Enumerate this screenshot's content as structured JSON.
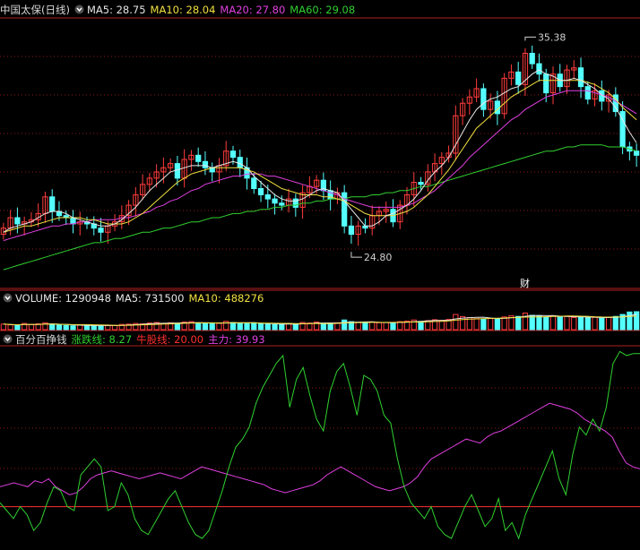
{
  "price_panel": {
    "stock_name": "中国太保(日线)",
    "ma_legend": [
      {
        "label": "MA5: 28.75",
        "color": "#e6e6e6"
      },
      {
        "label": "MA10: 28.04",
        "color": "#f0e040"
      },
      {
        "label": "MA20: 27.80",
        "color": "#e040e0"
      },
      {
        "label": "MA60: 29.08",
        "color": "#30d030"
      }
    ],
    "high_label": "35.38",
    "low_label": "24.80",
    "marker_label": "财"
  },
  "volume_panel": {
    "legend": [
      {
        "label": "VOLUME: 1290948",
        "color": "#e6e6e6"
      },
      {
        "label": "MA5: 731500",
        "color": "#e6e6e6"
      },
      {
        "label": "MA10: 488276",
        "color": "#f0e040"
      }
    ]
  },
  "indicator_panel": {
    "name": "百分百挣钱",
    "legend": [
      {
        "label": "涨跌线: 8.27",
        "color": "#30d030"
      },
      {
        "label": "牛股线: 20.00",
        "color": "#ff3030"
      },
      {
        "label": "主力: 39.93",
        "color": "#e040e0"
      }
    ]
  },
  "colors": {
    "up": "#ff3c3c",
    "down": "#54ffff",
    "grid": "#8b1a1a",
    "frame": "#b02020",
    "ma5": "#e6e6e6",
    "ma10": "#f0e040",
    "ma20": "#e040e0",
    "ma60": "#30d030"
  },
  "chart_data": [
    {
      "type": "candlestick",
      "price_range": [
        23.3,
        36.3
      ],
      "high": 35.38,
      "low": 24.8,
      "closes": [
        26.2,
        26.7,
        26.4,
        26.5,
        26.6,
        26.9,
        27.7,
        27.0,
        26.8,
        26.7,
        26.4,
        26.5,
        26.4,
        26.2,
        26.0,
        26.3,
        26.5,
        26.8,
        27.3,
        27.8,
        28.3,
        28.6,
        28.9,
        29.1,
        29.3,
        28.6,
        29.5,
        29.7,
        29.4,
        29.1,
        28.9,
        29.2,
        29.9,
        29.6,
        29.1,
        28.6,
        28.1,
        27.8,
        27.6,
        27.4,
        27.3,
        27.6,
        27.2,
        27.9,
        28.2,
        28.5,
        28.0,
        27.6,
        27.9,
        26.3,
        25.9,
        26.3,
        26.2,
        26.8,
        27.0,
        27.1,
        26.5,
        27.3,
        27.8,
        28.4,
        28.3,
        28.9,
        29.3,
        29.6,
        29.8,
        31.6,
        32.2,
        32.5,
        32.9,
        31.9,
        32.3,
        31.7,
        33.4,
        33.7,
        33.1,
        34.6,
        34.1,
        33.6,
        32.7,
        33.6,
        33.0,
        33.8,
        33.9,
        33.0,
        32.4,
        32.8,
        32.3,
        32.6,
        31.8,
        30.1,
        29.9,
        29.7
      ],
      "ma5": [
        26.0,
        26.2,
        26.3,
        26.4,
        26.5,
        26.7,
        26.9,
        27.0,
        27.0,
        26.9,
        26.7,
        26.6,
        26.5,
        26.4,
        26.3,
        26.3,
        26.4,
        26.6,
        26.9,
        27.2,
        27.6,
        28.0,
        28.3,
        28.6,
        28.9,
        29.0,
        29.1,
        29.2,
        29.2,
        29.2,
        29.1,
        29.2,
        29.3,
        29.4,
        29.3,
        29.1,
        28.7,
        28.4,
        28.1,
        27.8,
        27.6,
        27.5,
        27.5,
        27.6,
        27.8,
        28.0,
        28.1,
        28.0,
        27.9,
        27.5,
        27.1,
        26.7,
        26.3,
        26.3,
        26.5,
        26.8,
        26.9,
        27.1,
        27.3,
        27.6,
        28.0,
        28.5,
        28.9,
        29.2,
        29.6,
        30.2,
        30.8,
        31.4,
        31.9,
        32.2,
        32.4,
        32.5,
        32.7,
        32.9,
        33.0,
        33.3,
        33.6,
        33.8,
        33.6,
        33.5,
        33.3,
        33.3,
        33.4,
        33.3,
        33.1,
        32.9,
        32.6,
        32.4,
        32.0,
        31.4,
        30.8,
        30.3
      ],
      "ma10": [
        26.0,
        26.1,
        26.2,
        26.3,
        26.3,
        26.4,
        26.5,
        26.6,
        26.7,
        26.7,
        26.7,
        26.7,
        26.6,
        26.6,
        26.5,
        26.4,
        26.4,
        26.4,
        26.5,
        26.7,
        26.9,
        27.2,
        27.5,
        27.8,
        28.1,
        28.4,
        28.6,
        28.8,
        28.9,
        29.0,
        29.1,
        29.1,
        29.1,
        29.1,
        29.1,
        29.0,
        28.9,
        28.7,
        28.5,
        28.3,
        28.1,
        28.0,
        27.9,
        27.8,
        27.8,
        27.8,
        27.7,
        27.7,
        27.6,
        27.5,
        27.3,
        27.1,
        26.9,
        26.8,
        26.8,
        26.8,
        26.8,
        26.9,
        27.0,
        27.2,
        27.5,
        27.8,
        28.2,
        28.6,
        29.0,
        29.5,
        30.0,
        30.5,
        31.0,
        31.3,
        31.6,
        31.9,
        32.2,
        32.5,
        32.7,
        32.9,
        33.1,
        33.3,
        33.3,
        33.3,
        33.3,
        33.3,
        33.3,
        33.3,
        33.2,
        33.1,
        32.9,
        32.7,
        32.4,
        32.0,
        31.7,
        31.4
      ],
      "ma20": [
        25.6,
        25.7,
        25.8,
        25.9,
        26.0,
        26.1,
        26.2,
        26.3,
        26.3,
        26.4,
        26.4,
        26.5,
        26.5,
        26.6,
        26.6,
        26.6,
        26.6,
        26.7,
        26.7,
        26.8,
        26.9,
        27.0,
        27.2,
        27.3,
        27.5,
        27.6,
        27.8,
        28.0,
        28.1,
        28.3,
        28.4,
        28.5,
        28.6,
        28.7,
        28.7,
        28.8,
        28.8,
        28.8,
        28.7,
        28.7,
        28.6,
        28.5,
        28.4,
        28.3,
        28.2,
        28.1,
        28.0,
        27.9,
        27.8,
        27.6,
        27.5,
        27.4,
        27.3,
        27.2,
        27.2,
        27.2,
        27.2,
        27.2,
        27.3,
        27.4,
        27.6,
        27.8,
        28.0,
        28.3,
        28.6,
        28.9,
        29.2,
        29.6,
        29.9,
        30.2,
        30.5,
        30.8,
        31.1,
        31.4,
        31.6,
        31.9,
        32.1,
        32.3,
        32.5,
        32.6,
        32.7,
        32.8,
        32.8,
        32.8,
        32.8,
        32.7,
        32.6,
        32.5,
        32.3,
        32.1,
        31.9,
        31.7
      ],
      "ma60": [
        24.2,
        24.3,
        24.4,
        24.5,
        24.6,
        24.7,
        24.8,
        24.9,
        25.0,
        25.1,
        25.2,
        25.3,
        25.4,
        25.5,
        25.5,
        25.6,
        25.7,
        25.7,
        25.8,
        25.9,
        26.0,
        26.0,
        26.1,
        26.2,
        26.2,
        26.3,
        26.4,
        26.5,
        26.5,
        26.6,
        26.7,
        26.7,
        26.8,
        26.9,
        26.9,
        27.0,
        27.0,
        27.1,
        27.1,
        27.2,
        27.2,
        27.3,
        27.3,
        27.4,
        27.4,
        27.5,
        27.5,
        27.6,
        27.6,
        27.6,
        27.7,
        27.7,
        27.7,
        27.8,
        27.8,
        27.9,
        27.9,
        28.0,
        28.0,
        28.1,
        28.2,
        28.2,
        28.3,
        28.4,
        28.5,
        28.6,
        28.7,
        28.8,
        28.9,
        29.0,
        29.1,
        29.2,
        29.3,
        29.4,
        29.5,
        29.6,
        29.7,
        29.8,
        29.9,
        29.9,
        30.0,
        30.1,
        30.1,
        30.2,
        30.2,
        30.2,
        30.2,
        30.1,
        30.1,
        30.1,
        30.0,
        29.9
      ]
    },
    {
      "type": "bar",
      "series": "volume",
      "values": [
        40,
        35,
        30,
        45,
        38,
        42,
        50,
        36,
        33,
        30,
        28,
        34,
        30,
        27,
        32,
        29,
        31,
        38,
        40,
        45,
        42,
        48,
        52,
        44,
        50,
        46,
        55,
        58,
        48,
        44,
        42,
        46,
        60,
        52,
        48,
        44,
        50,
        42,
        40,
        38,
        36,
        45,
        40,
        52,
        48,
        55,
        46,
        42,
        50,
        70,
        58,
        52,
        48,
        56,
        50,
        52,
        46,
        58,
        62,
        70,
        60,
        66,
        72,
        68,
        74,
        110,
        95,
        88,
        80,
        78,
        82,
        76,
        92,
        100,
        96,
        120,
        104,
        98,
        90,
        100,
        94,
        96,
        88,
        92,
        86,
        90,
        84,
        88,
        96,
        110,
        128,
        130
      ]
    },
    {
      "type": "line",
      "series": "indicator",
      "ylim": [
        0,
        100
      ],
      "zhangdie": [
        22,
        18,
        14,
        20,
        16,
        8,
        12,
        22,
        30,
        28,
        20,
        18,
        36,
        40,
        44,
        40,
        18,
        20,
        32,
        26,
        14,
        8,
        6,
        12,
        18,
        24,
        28,
        20,
        12,
        6,
        4,
        8,
        18,
        28,
        40,
        50,
        54,
        60,
        72,
        80,
        86,
        92,
        96,
        70,
        84,
        90,
        76,
        64,
        58,
        78,
        88,
        92,
        80,
        66,
        86,
        84,
        78,
        66,
        62,
        44,
        30,
        22,
        18,
        14,
        20,
        10,
        6,
        4,
        12,
        20,
        26,
        18,
        10,
        14,
        24,
        8,
        12,
        4,
        16,
        24,
        32,
        40,
        48,
        34,
        26,
        46,
        60,
        56,
        64,
        58,
        70,
        92,
        98,
        96,
        97,
        97
      ],
      "niugu": 20,
      "zhuli": [
        30,
        31,
        32,
        31,
        30,
        33,
        32,
        34,
        30,
        28,
        26,
        27,
        30,
        34,
        36,
        37,
        38,
        37,
        36,
        35,
        34,
        35,
        36,
        37,
        36,
        35,
        34,
        36,
        38,
        40,
        39,
        38,
        37,
        36,
        35,
        34,
        33,
        32,
        31,
        29,
        28,
        27,
        28,
        29,
        30,
        31,
        33,
        36,
        38,
        40,
        38,
        36,
        34,
        32,
        30,
        29,
        28,
        29,
        30,
        32,
        35,
        40,
        44,
        46,
        48,
        50,
        52,
        54,
        53,
        52,
        55,
        57,
        58,
        60,
        62,
        64,
        66,
        68,
        70,
        72,
        71,
        70,
        69,
        67,
        64,
        62,
        60,
        58,
        55,
        48,
        42,
        40,
        39
      ]
    }
  ]
}
